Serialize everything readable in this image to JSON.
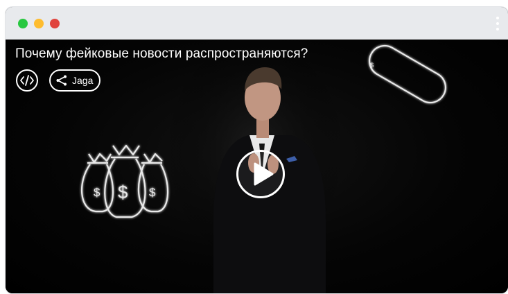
{
  "window": {
    "controls": [
      "green-dot",
      "yellow-dot",
      "red-dot"
    ],
    "menu_icon": "kebab-menu-icon"
  },
  "video": {
    "title": "Почему фейковые новости распространяются?",
    "share_label": "Jaga",
    "embed_icon": "code-icon",
    "share_icon": "share-icon",
    "play_icon": "play-icon"
  },
  "colors": {
    "titlebar": "#e8eaed",
    "green": "#28c840",
    "yellow": "#febc2e",
    "red": "#e0443e",
    "video_bg": "#000000",
    "overlay": "#ffffff"
  }
}
